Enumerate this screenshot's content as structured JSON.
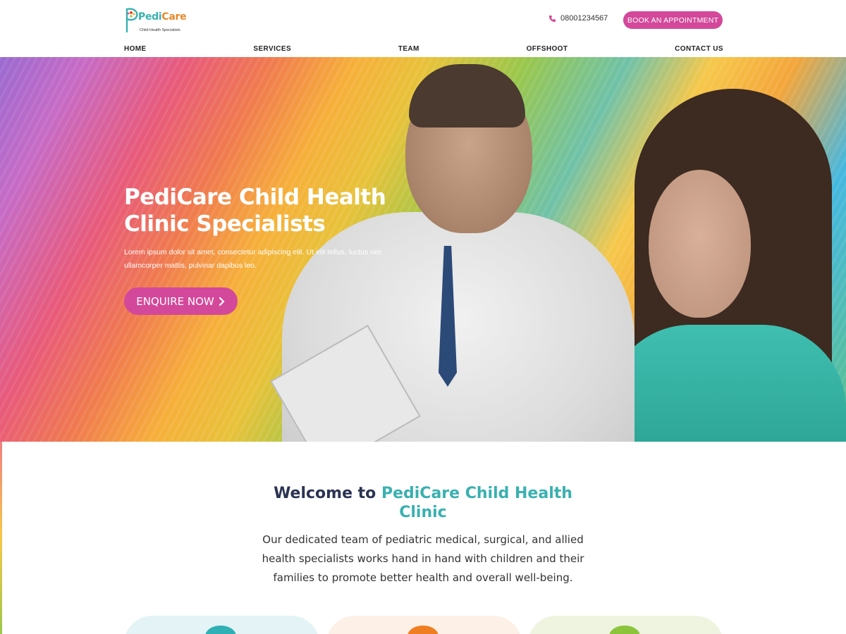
{
  "brand": {
    "name_part1": "Pedi",
    "name_part2": "Care",
    "tagline": "Child Health Specialists"
  },
  "header": {
    "phone": "08001234567",
    "book_label": "BOOK AN APPOINTMENT"
  },
  "nav": {
    "items": [
      {
        "label": "HOME"
      },
      {
        "label": "SERVICES"
      },
      {
        "label": "TEAM"
      },
      {
        "label": "OFFSHOOT"
      },
      {
        "label": "CONTACT US"
      }
    ]
  },
  "hero": {
    "title": "PediCare Child Health Clinic Specialists",
    "text": "Lorem ipsum dolor sit amet, consectetur adipiscing elit. Ut elit tellus, luctus nec ullamcorper mattis, pulvinar dapibus leo.",
    "cta_label": "ENQUIRE NOW",
    "cta_icon": "chevron-right-icon"
  },
  "welcome": {
    "prefix": "Welcome to ",
    "accent": "PediCare Child Health Clinic",
    "text": "Our dedicated team of pediatric medical, surgical, and allied health specialists works hand in hand with children and their families to promote better health and overall well-being."
  },
  "colors": {
    "accent_pink": "#d3489a",
    "accent_teal": "#3ab0b0",
    "heading_navy": "#2b3352"
  }
}
